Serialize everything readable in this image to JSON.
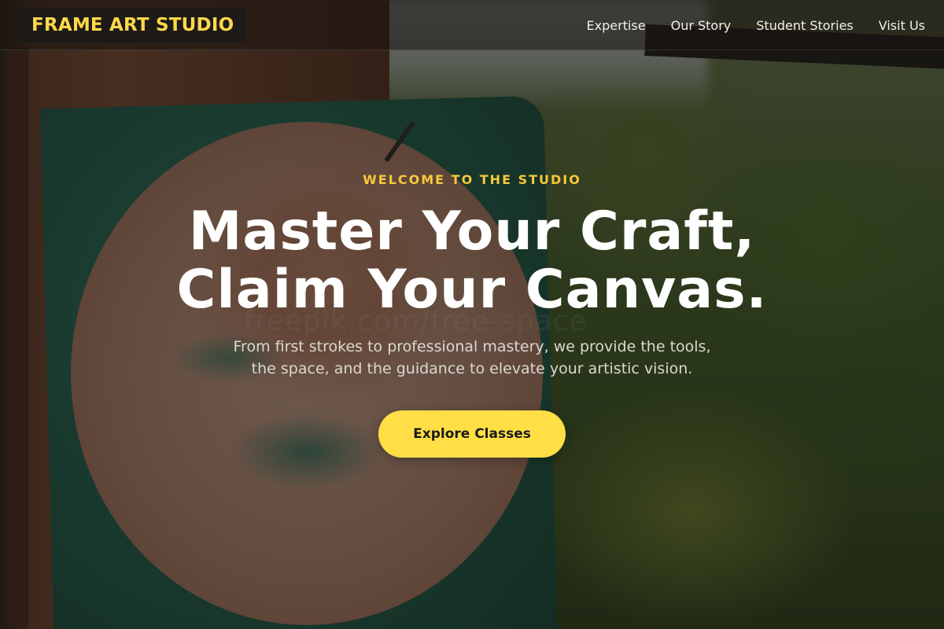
{
  "brand": {
    "name": "FRAME ART STUDIO",
    "accent_color": "#ffd84a"
  },
  "nav": {
    "items": [
      {
        "label": "Expertise"
      },
      {
        "label": "Our Story"
      },
      {
        "label": "Student Stories"
      },
      {
        "label": "Visit Us"
      }
    ]
  },
  "hero": {
    "eyebrow": "WELCOME TO THE STUDIO",
    "headline_line1": "Master Your Craft,",
    "headline_line2": "Claim Your Canvas.",
    "subtext_line1": "From first strokes to professional mastery, we provide the tools,",
    "subtext_line2": "the space, and the guidance to elevate your artistic vision.",
    "cta_label": "Explore Classes",
    "cta_color": "#ffdf45",
    "watermark_text": "freepik.com/free-space"
  }
}
